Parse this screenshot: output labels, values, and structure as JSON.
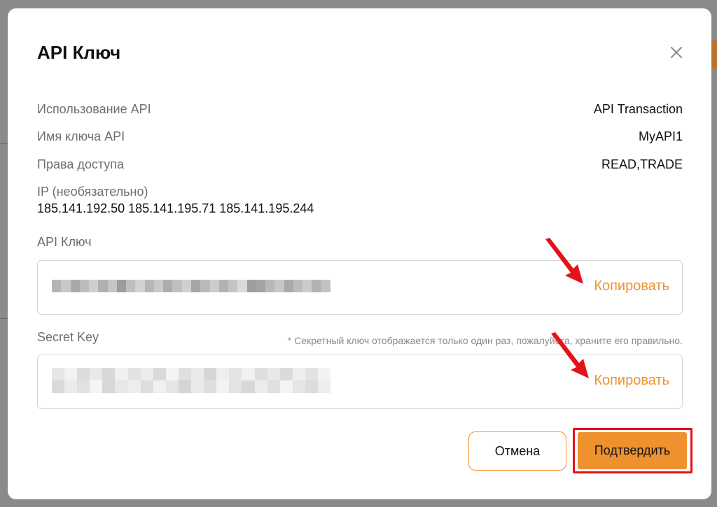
{
  "dialog": {
    "title": "API Ключ",
    "info": [
      {
        "label": "Использование API",
        "value": "API Transaction"
      },
      {
        "label": "Имя ключа API",
        "value": "MyAPI1"
      },
      {
        "label": "Права доступа",
        "value": "READ,TRADE"
      }
    ],
    "ip": {
      "label": "IP (необязательно)",
      "value": "185.141.192.50 185.141.195.71 185.141.195.244"
    },
    "api_key": {
      "label": "API Ключ",
      "copy_label": "Копировать"
    },
    "secret_key": {
      "label": "Secret Key",
      "note": "* Секретный ключ отображается только один раз, пожалуйста, храните его правильно.",
      "copy_label": "Копировать"
    },
    "buttons": {
      "cancel": "Отмена",
      "confirm": "Подтвердить"
    }
  },
  "colors": {
    "accent": "#f0912f",
    "highlight": "#e4121b",
    "overlay": "#8a8a8a"
  }
}
